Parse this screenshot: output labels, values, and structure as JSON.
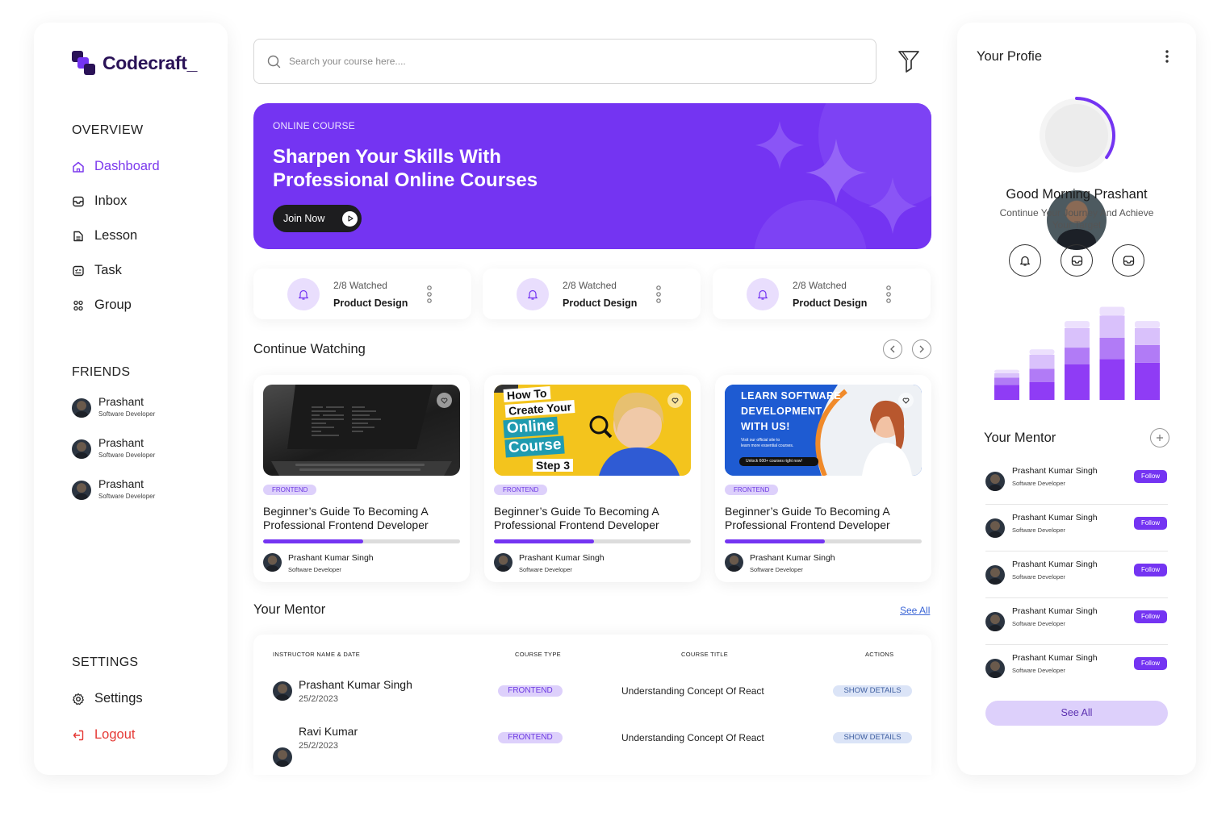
{
  "brand": {
    "name": "Codecraft_"
  },
  "sidebar": {
    "overview_title": "OVERVIEW",
    "nav": [
      {
        "label": "Dashboard",
        "icon": "home-icon",
        "active": true
      },
      {
        "label": "Inbox",
        "icon": "inbox-icon"
      },
      {
        "label": "Lesson",
        "icon": "lesson-icon"
      },
      {
        "label": "Task",
        "icon": "task-icon"
      },
      {
        "label": "Group",
        "icon": "group-icon"
      }
    ],
    "friends_title": "FRIENDS",
    "friends": [
      {
        "name": "Prashant",
        "role": "Software Developer"
      },
      {
        "name": "Prashant",
        "role": "Software Developer"
      },
      {
        "name": "Prashant",
        "role": "Software Developer"
      }
    ],
    "settings_title": "SETTINGS",
    "settings_label": "Settings",
    "logout_label": "Logout"
  },
  "search": {
    "placeholder": "Search your course here...."
  },
  "banner": {
    "kicker": "ONLINE COURSE",
    "title": "Sharpen  Your Skills With\nProfessional Online Courses",
    "button": "Join Now"
  },
  "stats": [
    {
      "watched": "2/8 Watched",
      "title": "Product Design"
    },
    {
      "watched": "2/8 Watched",
      "title": "Product Design"
    },
    {
      "watched": "2/8 Watched",
      "title": "Product Design"
    }
  ],
  "continue": {
    "title": "Continue Watching",
    "cards": [
      {
        "tag": "FRONTEND",
        "title": "Beginner’s Guide To Becoming A Professional Frontend Developer",
        "progress": 0.51,
        "author": "Prashant Kumar Singh",
        "role": "Software Developer"
      },
      {
        "tag": "FRONTEND",
        "title": "Beginner’s Guide To Becoming A Professional Frontend Developer",
        "progress": 0.51,
        "author": "Prashant Kumar Singh",
        "role": "Software Developer",
        "thumb_lines": [
          "How To",
          "Create Your",
          "Online",
          "Course",
          "Step 3"
        ]
      },
      {
        "tag": "FRONTEND",
        "title": "Beginner’s Guide To Becoming A Professional Frontend Developer",
        "progress": 0.51,
        "author": "Prashant Kumar Singh",
        "role": "Software Developer",
        "thumb_lines": [
          "LEARN SOFTWARE",
          "DEVELOPMENT",
          "WITH US!",
          "Visit our official site to",
          "learn more essential courses.",
          "Unlock 600+ courses right now!"
        ]
      }
    ]
  },
  "mentors_table": {
    "title": "Your Mentor",
    "see_all": "See All",
    "headers": [
      "INSTRUCTOR NAME & DATE",
      "COURSE TYPE",
      "COURSE TITLE",
      "ACTIONS"
    ],
    "rows": [
      {
        "name": "Prashant Kumar Singh",
        "date": "25/2/2023",
        "type": "FRONTEND",
        "course": "Understanding Concept Of React",
        "action": "SHOW DETAILS"
      },
      {
        "name": "Ravi Kumar",
        "date": "25/2/2023",
        "type": "FRONTEND",
        "course": "Understanding Concept Of React",
        "action": "SHOW DETAILS"
      }
    ]
  },
  "profile": {
    "title": "Your Profie",
    "greeting": "Good Morning Prashant",
    "subtitle": "Continue Your Journey And Achieve Your Target",
    "progress_ring": 0.35,
    "mini_chart": {
      "type": "bar",
      "stacks": [
        [
          0.17,
          0.08,
          0.05,
          0.04
        ],
        [
          0.2,
          0.15,
          0.16,
          0.06
        ],
        [
          0.4,
          0.19,
          0.22,
          0.08
        ],
        [
          0.46,
          0.24,
          0.25,
          0.1
        ],
        [
          0.42,
          0.2,
          0.19,
          0.08
        ]
      ],
      "colors": [
        "#8f3cf5",
        "#b17bf6",
        "#d9c1fb",
        "#ece0fd"
      ]
    },
    "mentor_title": "Your Mentor",
    "mentors": [
      {
        "name": "Prashant Kumar Singh",
        "role": "Software Developer",
        "action": "Follow"
      },
      {
        "name": "Prashant Kumar Singh",
        "role": "Software Developer",
        "action": "Follow"
      },
      {
        "name": "Prashant Kumar Singh",
        "role": "Software Developer",
        "action": "Follow"
      },
      {
        "name": "Prashant Kumar Singh",
        "role": "Software Developer",
        "action": "Follow"
      },
      {
        "name": "Prashant Kumar Singh",
        "role": "Software Developer",
        "action": "Follow"
      }
    ],
    "see_all": "See All"
  },
  "colors": {
    "accent": "#7434f2",
    "accent_light": "#ddd0fb",
    "danger": "#e53935"
  }
}
